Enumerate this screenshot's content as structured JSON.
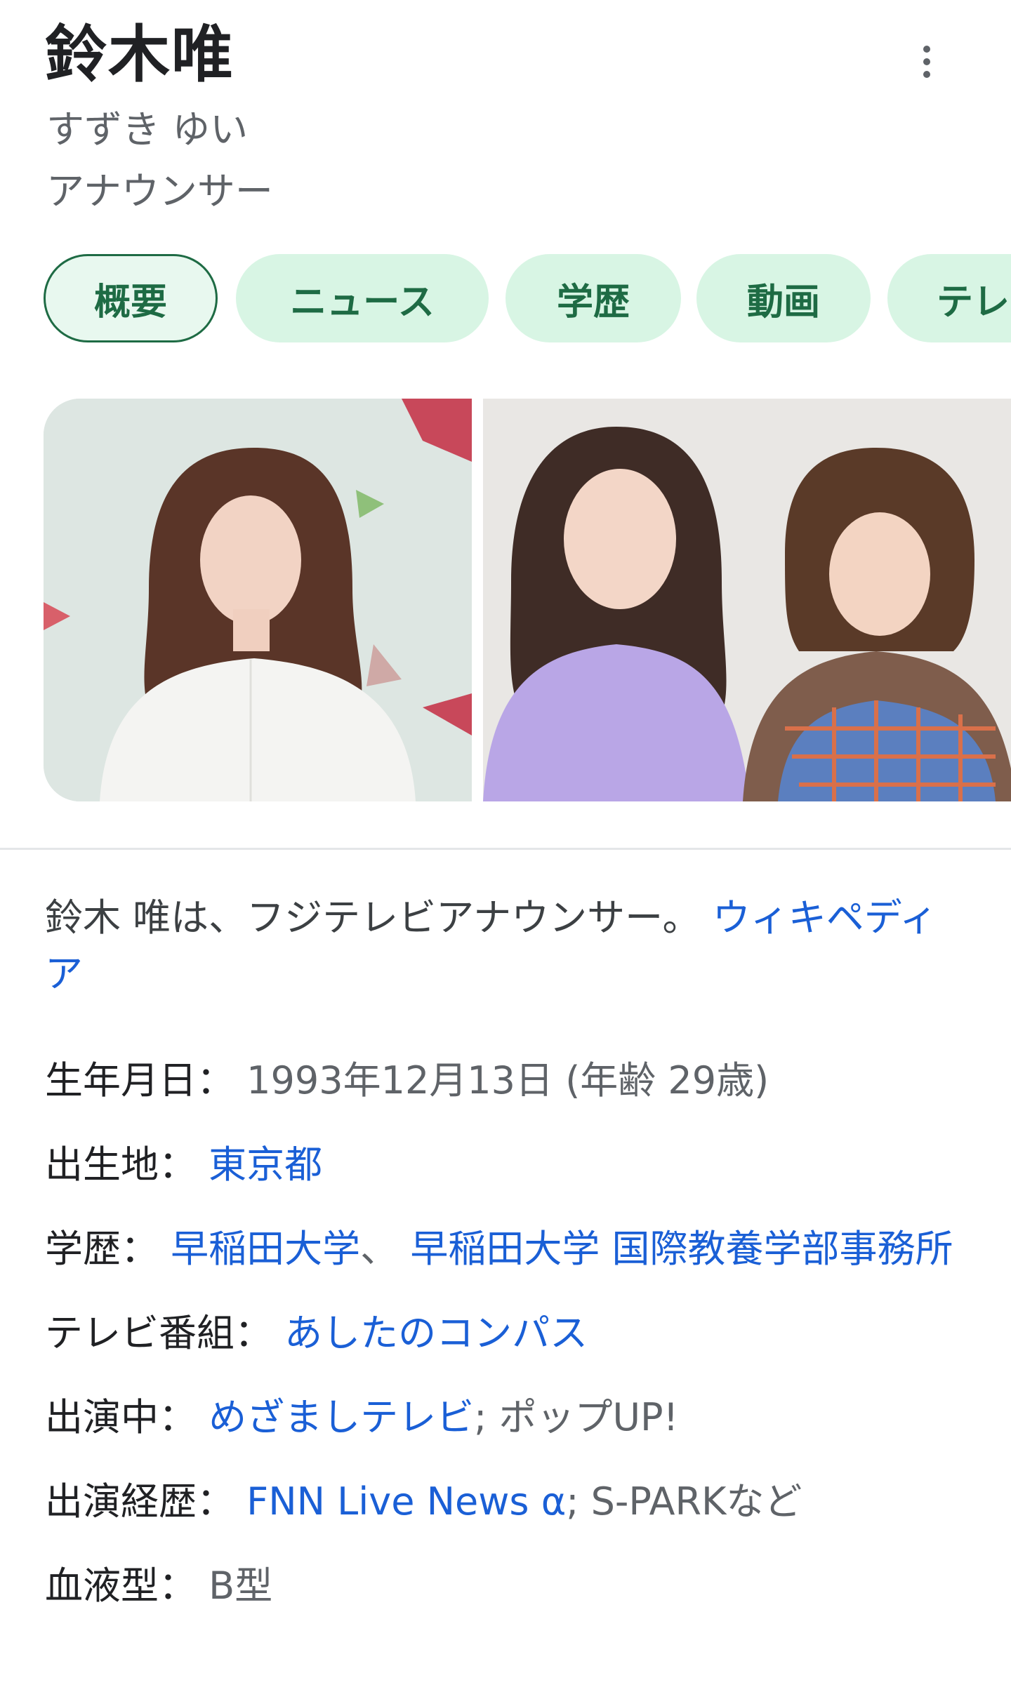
{
  "header": {
    "title": "鈴木唯",
    "reading": "すずき ゆい",
    "occupation": "アナウンサー"
  },
  "tabs": [
    {
      "label": "概要",
      "active": true
    },
    {
      "label": "ニュース",
      "active": false
    },
    {
      "label": "学歴",
      "active": false
    },
    {
      "label": "動画",
      "active": false
    },
    {
      "label": "テレ",
      "active": false
    }
  ],
  "description": {
    "text": "鈴木 唯は、フジテレビアナウンサー。",
    "source_link": "ウィキペディア"
  },
  "facts": {
    "birth": {
      "label": "生年月日：",
      "value": "1993年12月13日 (年齢 29歳)"
    },
    "birthplace": {
      "label": "出生地：",
      "link": "東京都"
    },
    "education": {
      "label": "学歴：",
      "link1": "早稲田大学",
      "sep": "、 ",
      "link2": "早稲田大学 国際教養学部事務所"
    },
    "tv": {
      "label": "テレビ番組：",
      "link": "あしたのコンパス"
    },
    "current": {
      "label": "出演中：",
      "link": "めざましテレビ",
      "rest": "; ポップUP!"
    },
    "past": {
      "label": "出演経歴：",
      "link": "FNN Live News α",
      "rest": "; S-PARKなど"
    },
    "blood": {
      "label": "血液型：",
      "value": "B型"
    }
  },
  "colors": {
    "chip_bg": "#d8f5e4",
    "chip_text": "#1e6b44",
    "link": "#1a5fd6"
  }
}
